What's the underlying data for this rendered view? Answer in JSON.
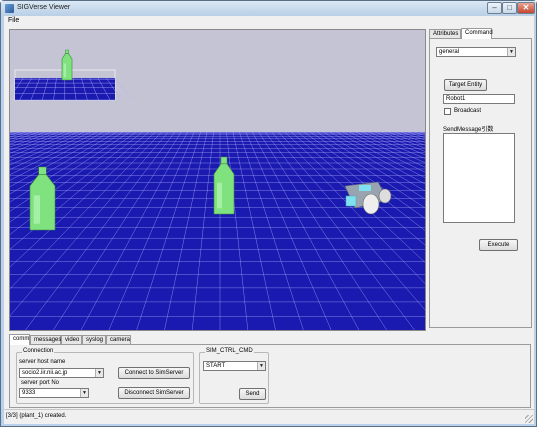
{
  "window": {
    "title": "SIGVerse Viewer"
  },
  "window_buttons": {
    "minimize": "–",
    "maximize": "□",
    "close": "✕"
  },
  "menu": {
    "file": "File"
  },
  "right_panel": {
    "tabs": [
      "Attributes",
      "Command"
    ],
    "active_tab": "Command",
    "command_select": "general",
    "target_entity_button": "Target Entity",
    "target_entity_value": "Robot1",
    "broadcast_label": "Broadcast",
    "send_message_label": "SendMessage引数",
    "send_message_value": "",
    "execute_button": "Execute"
  },
  "bottom_panel": {
    "tabs": [
      "comm",
      "messages",
      "video",
      "syslog",
      "camera"
    ],
    "active_tab": "comm",
    "connection": {
      "group_title": "Connection",
      "host_label": "server host name",
      "host_value": "socio2.iir.nii.ac.jp",
      "port_label": "server port No",
      "port_value": "9333",
      "connect_button": "Connect to SimServer",
      "disconnect_button": "Disconnect SimServer"
    },
    "sim_ctrl": {
      "group_title": "SIM_CTRL_CMD",
      "command_value": "START",
      "send_button": "Send"
    }
  },
  "status": {
    "text": "[3/3] (plant_1) created."
  },
  "scene_colors": {
    "sky": "#c4c4d4",
    "floor": "#1a1ab0",
    "grid_line": "#b0b0ff",
    "bottle": "#7fe27f",
    "robot": "#9aa4b0",
    "robot_accent": "#7fe0f0"
  }
}
